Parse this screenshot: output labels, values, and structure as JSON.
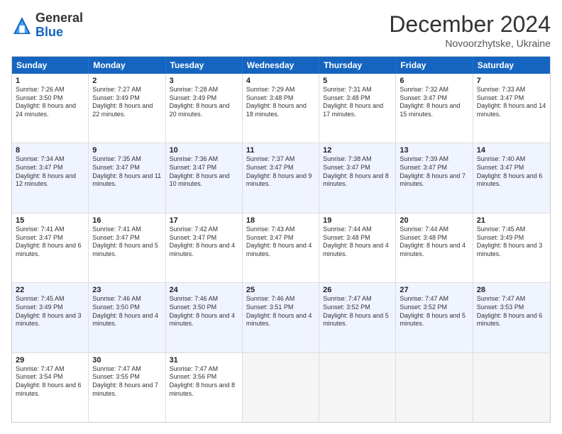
{
  "header": {
    "logo_general": "General",
    "logo_blue": "Blue",
    "month_title": "December 2024",
    "location": "Novoorzhytske, Ukraine"
  },
  "weekdays": [
    "Sunday",
    "Monday",
    "Tuesday",
    "Wednesday",
    "Thursday",
    "Friday",
    "Saturday"
  ],
  "rows": [
    {
      "cells": [
        {
          "day": "1",
          "sunrise": "7:26 AM",
          "sunset": "3:50 PM",
          "daylight": "8 hours and 24 minutes."
        },
        {
          "day": "2",
          "sunrise": "7:27 AM",
          "sunset": "3:49 PM",
          "daylight": "8 hours and 22 minutes."
        },
        {
          "day": "3",
          "sunrise": "7:28 AM",
          "sunset": "3:49 PM",
          "daylight": "8 hours and 20 minutes."
        },
        {
          "day": "4",
          "sunrise": "7:29 AM",
          "sunset": "3:48 PM",
          "daylight": "8 hours and 18 minutes."
        },
        {
          "day": "5",
          "sunrise": "7:31 AM",
          "sunset": "3:48 PM",
          "daylight": "8 hours and 17 minutes."
        },
        {
          "day": "6",
          "sunrise": "7:32 AM",
          "sunset": "3:47 PM",
          "daylight": "8 hours and 15 minutes."
        },
        {
          "day": "7",
          "sunrise": "7:33 AM",
          "sunset": "3:47 PM",
          "daylight": "8 hours and 14 minutes."
        }
      ]
    },
    {
      "cells": [
        {
          "day": "8",
          "sunrise": "7:34 AM",
          "sunset": "3:47 PM",
          "daylight": "8 hours and 12 minutes."
        },
        {
          "day": "9",
          "sunrise": "7:35 AM",
          "sunset": "3:47 PM",
          "daylight": "8 hours and 11 minutes."
        },
        {
          "day": "10",
          "sunrise": "7:36 AM",
          "sunset": "3:47 PM",
          "daylight": "8 hours and 10 minutes."
        },
        {
          "day": "11",
          "sunrise": "7:37 AM",
          "sunset": "3:47 PM",
          "daylight": "8 hours and 9 minutes."
        },
        {
          "day": "12",
          "sunrise": "7:38 AM",
          "sunset": "3:47 PM",
          "daylight": "8 hours and 8 minutes."
        },
        {
          "day": "13",
          "sunrise": "7:39 AM",
          "sunset": "3:47 PM",
          "daylight": "8 hours and 7 minutes."
        },
        {
          "day": "14",
          "sunrise": "7:40 AM",
          "sunset": "3:47 PM",
          "daylight": "8 hours and 6 minutes."
        }
      ]
    },
    {
      "cells": [
        {
          "day": "15",
          "sunrise": "7:41 AM",
          "sunset": "3:47 PM",
          "daylight": "8 hours and 6 minutes."
        },
        {
          "day": "16",
          "sunrise": "7:41 AM",
          "sunset": "3:47 PM",
          "daylight": "8 hours and 5 minutes."
        },
        {
          "day": "17",
          "sunrise": "7:42 AM",
          "sunset": "3:47 PM",
          "daylight": "8 hours and 4 minutes."
        },
        {
          "day": "18",
          "sunrise": "7:43 AM",
          "sunset": "3:47 PM",
          "daylight": "8 hours and 4 minutes."
        },
        {
          "day": "19",
          "sunrise": "7:44 AM",
          "sunset": "3:48 PM",
          "daylight": "8 hours and 4 minutes."
        },
        {
          "day": "20",
          "sunrise": "7:44 AM",
          "sunset": "3:48 PM",
          "daylight": "8 hours and 4 minutes."
        },
        {
          "day": "21",
          "sunrise": "7:45 AM",
          "sunset": "3:49 PM",
          "daylight": "8 hours and 3 minutes."
        }
      ]
    },
    {
      "cells": [
        {
          "day": "22",
          "sunrise": "7:45 AM",
          "sunset": "3:49 PM",
          "daylight": "8 hours and 3 minutes."
        },
        {
          "day": "23",
          "sunrise": "7:46 AM",
          "sunset": "3:50 PM",
          "daylight": "8 hours and 4 minutes."
        },
        {
          "day": "24",
          "sunrise": "7:46 AM",
          "sunset": "3:50 PM",
          "daylight": "8 hours and 4 minutes."
        },
        {
          "day": "25",
          "sunrise": "7:46 AM",
          "sunset": "3:51 PM",
          "daylight": "8 hours and 4 minutes."
        },
        {
          "day": "26",
          "sunrise": "7:47 AM",
          "sunset": "3:52 PM",
          "daylight": "8 hours and 5 minutes."
        },
        {
          "day": "27",
          "sunrise": "7:47 AM",
          "sunset": "3:52 PM",
          "daylight": "8 hours and 5 minutes."
        },
        {
          "day": "28",
          "sunrise": "7:47 AM",
          "sunset": "3:53 PM",
          "daylight": "8 hours and 6 minutes."
        }
      ]
    },
    {
      "cells": [
        {
          "day": "29",
          "sunrise": "7:47 AM",
          "sunset": "3:54 PM",
          "daylight": "8 hours and 6 minutes."
        },
        {
          "day": "30",
          "sunrise": "7:47 AM",
          "sunset": "3:55 PM",
          "daylight": "8 hours and 7 minutes."
        },
        {
          "day": "31",
          "sunrise": "7:47 AM",
          "sunset": "3:56 PM",
          "daylight": "8 hours and 8 minutes."
        },
        {
          "day": "",
          "sunrise": "",
          "sunset": "",
          "daylight": ""
        },
        {
          "day": "",
          "sunrise": "",
          "sunset": "",
          "daylight": ""
        },
        {
          "day": "",
          "sunrise": "",
          "sunset": "",
          "daylight": ""
        },
        {
          "day": "",
          "sunrise": "",
          "sunset": "",
          "daylight": ""
        }
      ]
    }
  ]
}
